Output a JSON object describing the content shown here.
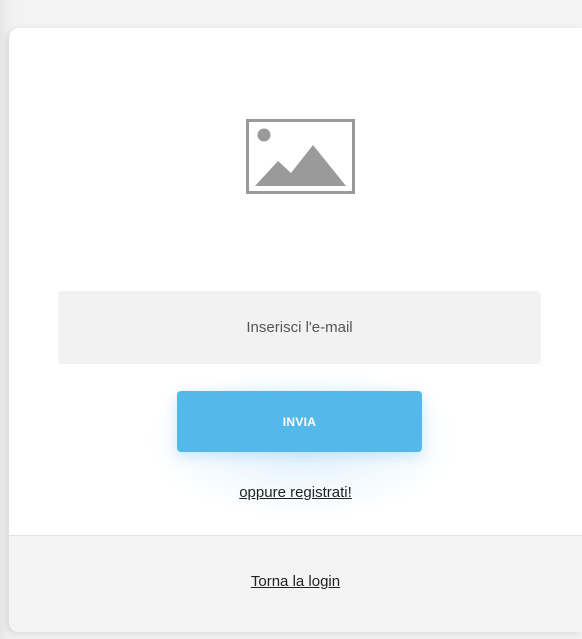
{
  "logo": {
    "icon": "image-placeholder-icon"
  },
  "form": {
    "email_placeholder": "Inserisci l'e-mail",
    "email_value": "",
    "submit_label": "INVIA",
    "register_link": "oppure registrati!"
  },
  "footer": {
    "back_to_login": "Torna la login"
  },
  "colors": {
    "accent": "#55b8ea",
    "field_background": "#f2f2f2",
    "footer_background": "#f4f4f4",
    "icon_gray": "#9a9a9a"
  }
}
